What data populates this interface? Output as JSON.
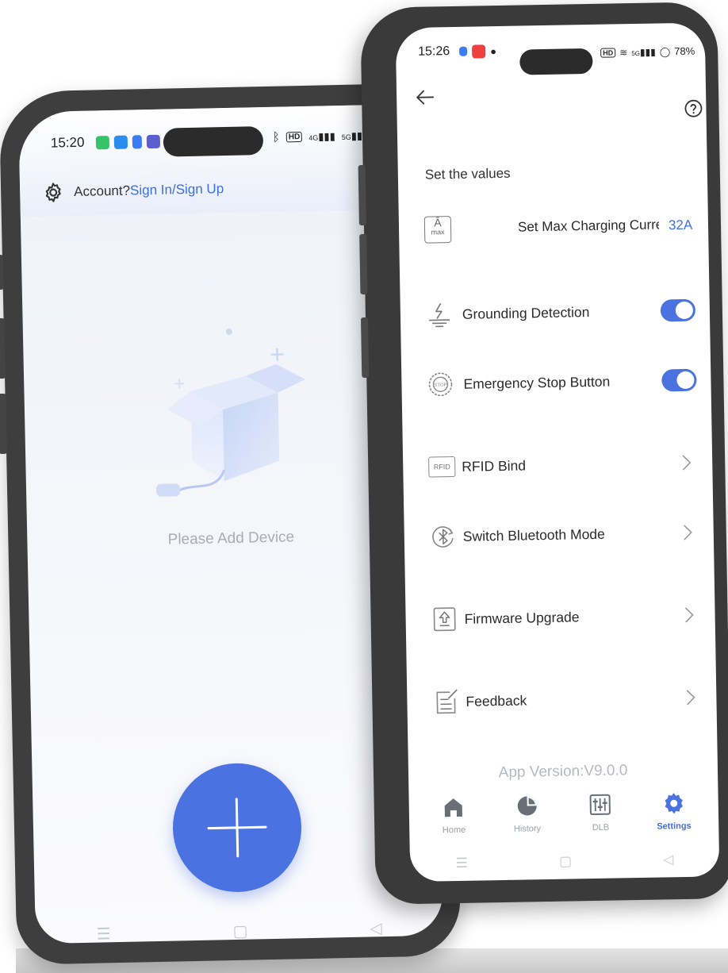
{
  "left_phone": {
    "status": {
      "time": "15:20",
      "badges": "HD",
      "signal_1": "4G",
      "signal_2": "5G"
    },
    "header": {
      "account_prompt": "Account?",
      "sign_link": "Sign In/Sign Up"
    },
    "empty_state": {
      "message": "Please Add Device"
    },
    "icons": [
      "gear-icon",
      "open-box-icon",
      "plug-icon",
      "plus-icon"
    ]
  },
  "right_phone": {
    "status": {
      "time": "15:26",
      "badges": "HD",
      "signal": "5G",
      "battery": "78%"
    },
    "section_title": "Set the values",
    "max_current": {
      "icon_text": "max",
      "label": "Set Max Charging Current",
      "value": "32A"
    },
    "toggles": [
      {
        "label": "Grounding Detection",
        "on": true
      },
      {
        "label": "Emergency Stop Button",
        "on": true
      }
    ],
    "menu": [
      {
        "label": "RFID Bind",
        "icon_text": "RFID"
      },
      {
        "label": "Switch Bluetooth Mode"
      },
      {
        "label": "Firmware Upgrade"
      },
      {
        "label": "Feedback"
      }
    ],
    "app_version": "App Version:V9.0.0",
    "tabs": [
      {
        "label": "Home",
        "icon": "home-icon"
      },
      {
        "label": "History",
        "icon": "pie-chart-icon"
      },
      {
        "label": "DLB",
        "icon": "sliders-icon"
      },
      {
        "label": "Settings",
        "icon": "gear-icon",
        "active": true
      }
    ],
    "accent_color": "#4a72e0"
  }
}
